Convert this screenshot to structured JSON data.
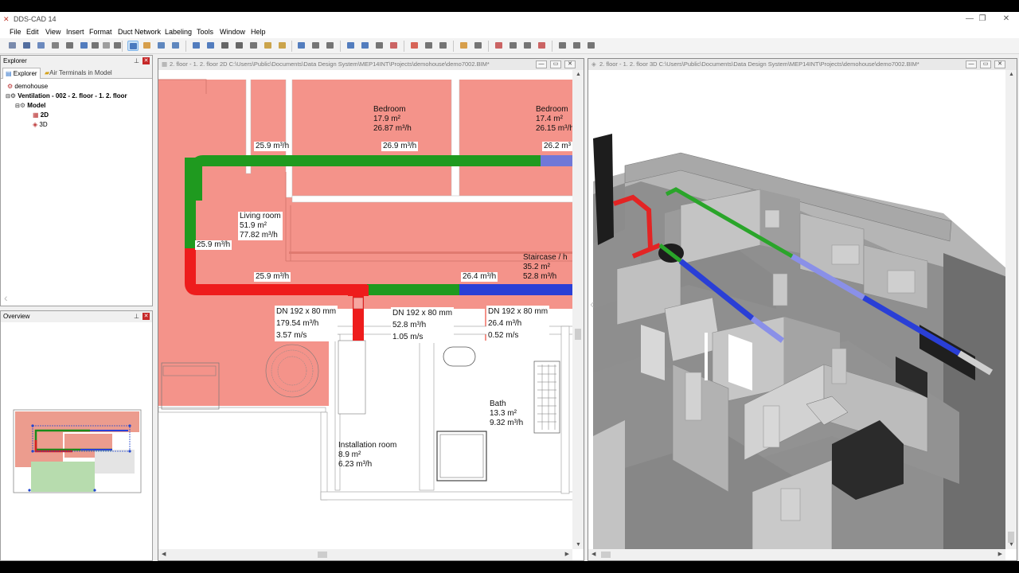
{
  "app": {
    "title": "DDS-CAD 14"
  },
  "menu": [
    "File",
    "Edit",
    "View",
    "Insert",
    "Format",
    "Duct Network",
    "Labeling",
    "Tools",
    "Window",
    "Help"
  ],
  "explorer": {
    "title": "Explorer",
    "tabs": [
      "Explorer",
      "Air Terminals in Model"
    ],
    "tree": {
      "root": "demohouse",
      "network": "Ventilation - 002 - 2. floor - 1. 2. floor",
      "model": "Model",
      "view2d": "2D",
      "view3d": "3D"
    }
  },
  "overview": {
    "title": "Overview"
  },
  "doc2d": {
    "title": "2. floor - 1. 2. floor  2D  C:\\Users\\Public\\Documents\\Data Design System\\MEP14INT\\Projects\\demohouse\\demo7002.BIM*"
  },
  "doc3d": {
    "title": "2. floor - 1. 2. floor  3D  C:\\Users\\Public\\Documents\\Data Design System\\MEP14INT\\Projects\\demohouse\\demo7002.BIM*"
  },
  "plan": {
    "rooms": [
      {
        "name": "Bedroom",
        "area": "17.9 m²",
        "flow": "26.87 m³/h"
      },
      {
        "name": "Bedroom",
        "area": "17.4 m²",
        "flow": "26.15 m³/h"
      },
      {
        "name": "Living room",
        "area": "51.9 m²",
        "flow": "77.82 m³/h"
      },
      {
        "name": "Staircase / h",
        "area": "35.2 m²",
        "flow": "52.8 m³/h"
      },
      {
        "name": "Bath",
        "area": "13.3 m²",
        "flow": "9.32 m³/h"
      },
      {
        "name": "Installation room",
        "area": "8.9 m²",
        "flow": "6.23 m³/h"
      }
    ],
    "terminal_flows": [
      "25.9 m³/h",
      "26.9 m³/h",
      "26.2 m³",
      "25.9 m³/h",
      "25.9 m³/h",
      "26.4 m³/h"
    ],
    "ducts": [
      {
        "dn": "DN 192 x 80 mm",
        "flow": "179.54 m³/h",
        "velocity": "3.57 m/s"
      },
      {
        "dn": "DN 192 x 80 mm",
        "flow": "52.8 m³/h",
        "velocity": "1.05 m/s"
      },
      {
        "dn": "DN 192 x 80 mm",
        "flow": "26.4 m³/h",
        "velocity": "0.52 m/s"
      }
    ]
  },
  "colors": {
    "room_fill": "#f4938a",
    "duct_green": "#1f9a1f",
    "duct_red": "#ee1c1c",
    "duct_blue": "#2a3fd6",
    "wall_3d": "#9c9c9c"
  }
}
